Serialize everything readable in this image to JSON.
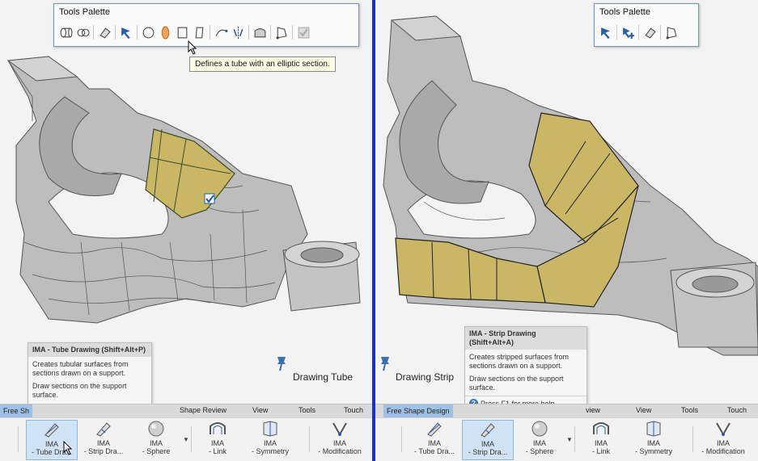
{
  "left": {
    "palette": {
      "title": "Tools Palette",
      "icons": [
        "tube-icon",
        "link-icon",
        "eraser-icon",
        "move-icon",
        "circle-section-icon",
        "ellipse-section-icon",
        "rectangle-section-icon",
        "strip-icon",
        "curve-icon",
        "symmetry-icon",
        "surface-icon",
        "analysis-icon",
        "validate-icon"
      ]
    },
    "hover_tooltip": "Defines a tube with an elliptic section.",
    "tip": {
      "title": "IMA - Tube Drawing (Shift+Alt+P)",
      "body1": "Creates tubular surfaces from sections drawn on a support.",
      "body2": "Draw sections on the support surface."
    },
    "caption": "Drawing Tube",
    "menu": [
      {
        "label": "Free Sh"
      },
      {
        "label": "Shape Review"
      },
      {
        "label": "View"
      },
      {
        "label": "Tools"
      },
      {
        "label": "Touch"
      }
    ],
    "ribbon": [
      {
        "line1": "IMA",
        "line2": "- Tube Dra...",
        "icon": "tube-drawing-icon",
        "active": true
      },
      {
        "line1": "IMA",
        "line2": "- Strip Dra...",
        "icon": "strip-drawing-icon",
        "active": false
      },
      {
        "line1": "IMA",
        "line2": "- Sphere",
        "icon": "sphere-icon",
        "active": false
      },
      {
        "line1": "IMA",
        "line2": "- Link",
        "icon": "link-icon",
        "active": false
      },
      {
        "line1": "IMA",
        "line2": "- Symmetry",
        "icon": "symmetry-icon",
        "active": false
      },
      {
        "line1": "IMA",
        "line2": "- Modification",
        "icon": "modification-icon",
        "active": false
      }
    ]
  },
  "right": {
    "palette": {
      "title": "Tools Palette",
      "icons": [
        "move-icon",
        "add-point-icon",
        "eraser-icon",
        "analysis-icon"
      ]
    },
    "tip": {
      "title": "IMA - Strip Drawing (Shift+Alt+A)",
      "body1": "Creates stripped surfaces from sections drawn on a support.",
      "body2": "Draw sections on the support surface.",
      "help": "Press F1 for more help."
    },
    "caption": "Drawing Strip",
    "menu": [
      {
        "label": "Free Shape Design"
      },
      {
        "label": "view"
      },
      {
        "label": "View"
      },
      {
        "label": "Tools"
      },
      {
        "label": "Touch"
      }
    ],
    "ribbon": [
      {
        "line1": "IMA",
        "line2": "- Tube Dra...",
        "icon": "tube-drawing-icon",
        "active": false
      },
      {
        "line1": "IMA",
        "line2": "- Strip Dra...",
        "icon": "strip-drawing-icon",
        "active": true
      },
      {
        "line1": "IMA",
        "line2": "- Sphere",
        "icon": "sphere-icon",
        "active": false
      },
      {
        "line1": "IMA",
        "line2": "- Link",
        "icon": "link-icon",
        "active": false
      },
      {
        "line1": "IMA",
        "line2": "- Symmetry",
        "icon": "symmetry-icon",
        "active": false
      },
      {
        "line1": "IMA",
        "line2": "- Modification",
        "icon": "modification-icon",
        "active": false
      }
    ]
  },
  "colors": {
    "accent": "#1d2fc4",
    "surface": "#c6b562",
    "model": "#b8b8b8",
    "active_tab": "#9fc1e3"
  }
}
